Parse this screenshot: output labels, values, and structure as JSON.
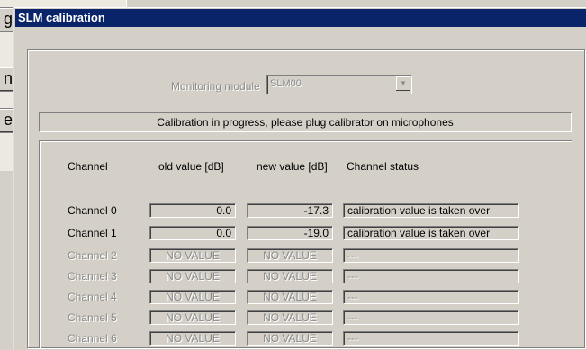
{
  "background": {
    "button_glyphs": [
      "g",
      "n",
      "e"
    ]
  },
  "dialog": {
    "title": "SLM calibration",
    "monitoring_label": "Monitoring module",
    "monitoring_value": "SLM00",
    "status_message": "Calibration in progress, please plug calibrator on microphones",
    "headers": {
      "channel": "Channel",
      "old_value": "old value [dB]",
      "new_value": "new value [dB]",
      "status": "Channel status"
    },
    "rows": [
      {
        "label": "Channel  0",
        "old": "0.0",
        "new": "-17.3",
        "status": "calibration value is taken over",
        "enabled": true
      },
      {
        "label": "Channel  1",
        "old": "0.0",
        "new": "-19.0",
        "status": "calibration value is taken over",
        "enabled": true
      },
      {
        "label": "Channel  2",
        "old": "NO VALUE",
        "new": "NO VALUE",
        "status": "---",
        "enabled": false
      },
      {
        "label": "Channel  3",
        "old": "NO VALUE",
        "new": "NO VALUE",
        "status": "---",
        "enabled": false
      },
      {
        "label": "Channel  4",
        "old": "NO VALUE",
        "new": "NO VALUE",
        "status": "---",
        "enabled": false
      },
      {
        "label": "Channel  5",
        "old": "NO VALUE",
        "new": "NO VALUE",
        "status": "---",
        "enabled": false
      },
      {
        "label": "Channel  6",
        "old": "NO VALUE",
        "new": "NO VALUE",
        "status": "---",
        "enabled": false
      }
    ]
  }
}
